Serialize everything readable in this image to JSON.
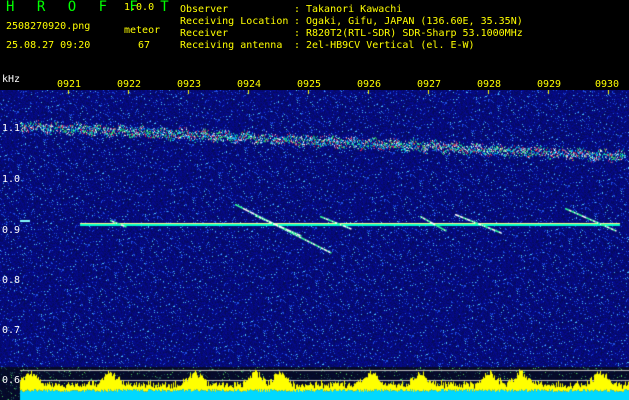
{
  "header": {
    "app_title": "H R O F F T",
    "version": "1.0.0",
    "file_name": "2508270920.png",
    "meteor_label": "meteor",
    "date_time": "25.08.27 09:20",
    "meteor_count": "67",
    "rows": [
      {
        "label": "Observer",
        "value": "Takanori Kawachi"
      },
      {
        "label": "Receiving Location",
        "value": "Ogaki, Gifu, JAPAN (136.60E, 35.35N)"
      },
      {
        "label": "Receiver",
        "value": "R820T2(RTL-SDR) SDR-Sharp 53.1000MHz"
      },
      {
        "label": "Receiving antenna",
        "value": "2el-HB9CV Vertical (el. E-W)"
      }
    ],
    "separator": ":"
  },
  "axis": {
    "unit": "kHz",
    "time_ticks": [
      "0921",
      "0922",
      "0923",
      "0924",
      "0925",
      "0926",
      "0927",
      "0928",
      "0929",
      "0930"
    ],
    "freq_ticks": [
      "1.1",
      "1.0",
      "0.9",
      "0.8",
      "0.7",
      "0.6"
    ]
  },
  "colors": {
    "background": "#000000",
    "noise": "#0a1a8a",
    "signal": "#00ff66",
    "echo": "#ffffff",
    "power_bar": "#ffff00",
    "base_bar": "#00e0ff"
  }
}
